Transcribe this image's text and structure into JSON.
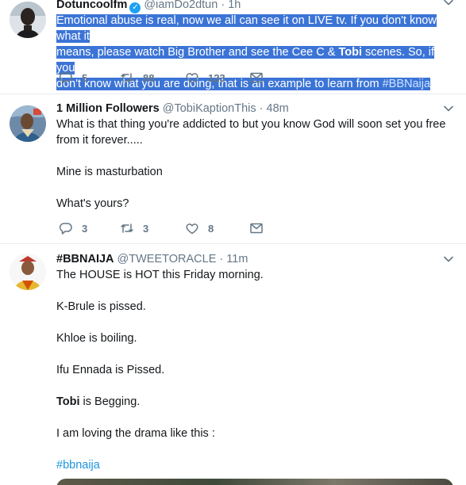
{
  "tweets": [
    {
      "name": "Dotuncoolfm",
      "handle": "@iamDo2dtun",
      "time": "· 1h",
      "verified": true,
      "text_lines": [
        "Emotional abuse is real, now we all can see it on LIVE tv. If you don't know what it",
        "means, please watch Big Brother and see the Cee C & ",
        "Tobi",
        " scenes. So, if you",
        "don't know what you are doing, that is an example to learn from ",
        "#BBNaija"
      ],
      "replies": "5",
      "retweets": "88",
      "likes": "123"
    },
    {
      "name": "1 Million Followers",
      "handle": "@TobiKaptionThis",
      "time": "· 48m",
      "paragraphs": [
        "What is that thing you're addicted to but you know God will soon set you free",
        "from it forever.....",
        "Mine is masturbation",
        "What's yours?"
      ],
      "replies": "3",
      "retweets": "3",
      "likes": "8"
    },
    {
      "name": "#BBNAIJA",
      "handle": "@TWEETORACLE",
      "time": "· 11m",
      "paragraphs": [
        "The HOUSE is HOT this Friday morning.",
        "K-Brule is pissed.",
        "Khloe is boiling.",
        "Ifu Ennada is Pissed.",
        "Tobi",
        " is Begging.",
        "I am loving the drama like this :",
        "#bbnaija"
      ]
    }
  ],
  "colors": {
    "accent": "#1da1f2",
    "hashtag": "#1b95e0",
    "selection": "#3b74d6",
    "muted": "#657786"
  },
  "icons": [
    "reply-icon",
    "retweet-icon",
    "like-icon",
    "message-icon",
    "chevron-down-icon",
    "verified-icon"
  ]
}
